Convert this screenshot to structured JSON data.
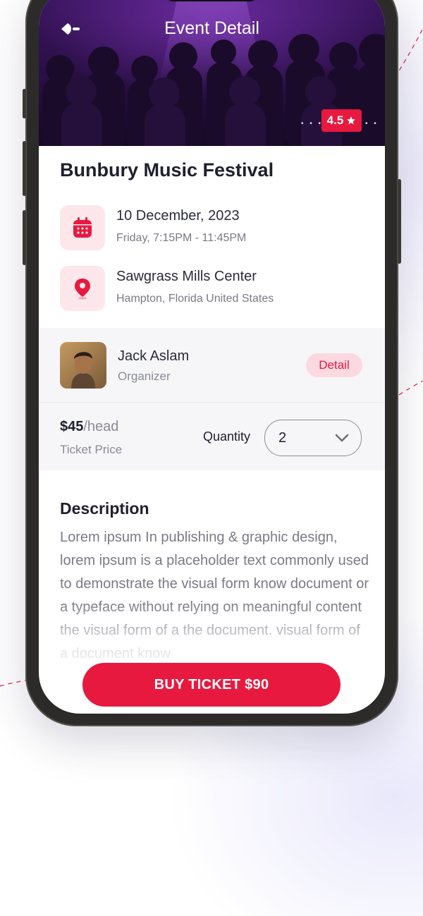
{
  "header": {
    "title": "Event Detail",
    "rating": "4.5"
  },
  "event": {
    "title": "Bunbury Music Festival",
    "date": "10 December, 2023",
    "time": "Friday, 7:15PM - 11:45PM",
    "venue": "Sawgrass Mills Center",
    "location": "Hampton, Florida United States"
  },
  "organizer": {
    "name": "Jack Aslam",
    "role": "Organizer",
    "detail_label": "Detail"
  },
  "ticket": {
    "price": "$45",
    "unit": "/head",
    "price_label": "Ticket Price",
    "quantity_label": "Quantity",
    "quantity": "2"
  },
  "description": {
    "title": "Description",
    "text": "Lorem ipsum In publishing & graphic design, lorem ipsum is a placeholder text commonly used to demonstrate the visual form know document or a typeface without relying on meaningful content the visual form of a the document. visual form of a document know"
  },
  "buy_button": "BUY TICKET $90",
  "colors": {
    "accent": "#e8193f",
    "accent_soft": "#fde7eb",
    "text_dark": "#1f1f2e",
    "text_muted": "#7a7a86"
  }
}
